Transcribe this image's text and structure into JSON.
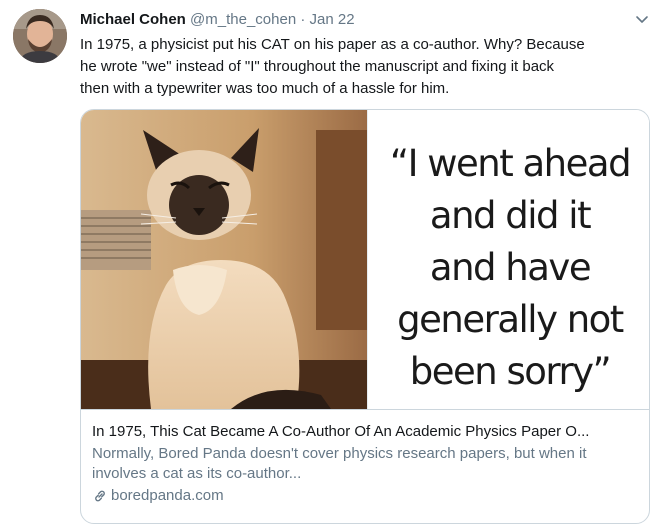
{
  "tweet": {
    "author_name": "Michael Cohen",
    "handle": "@m_the_cohen",
    "separator": "·",
    "date": "Jan 22",
    "text": "In 1975, a physicist put his CAT on his paper as a co-author. Why? Because\nhe wrote \"we\" instead of \"I\" throughout the manuscript and fixing it back\nthen with a typewriter was too much of a hassle for  him.",
    "menu_icon": "chevron-down-icon"
  },
  "card": {
    "quote_lines": [
      "“I went ahead",
      "and did it",
      "and have",
      "generally not",
      "been sorry”"
    ],
    "title": "In 1975, This Cat Became A Co-Author Of An Academic Physics Paper O...",
    "description": "Normally, Bored Panda doesn't cover physics research papers, but when it involves a cat as its co-author...",
    "domain": "boredpanda.com",
    "link_icon": "link-icon"
  },
  "colors": {
    "text_primary": "#14171a",
    "text_secondary": "#657786",
    "border": "#ccd6dd"
  }
}
